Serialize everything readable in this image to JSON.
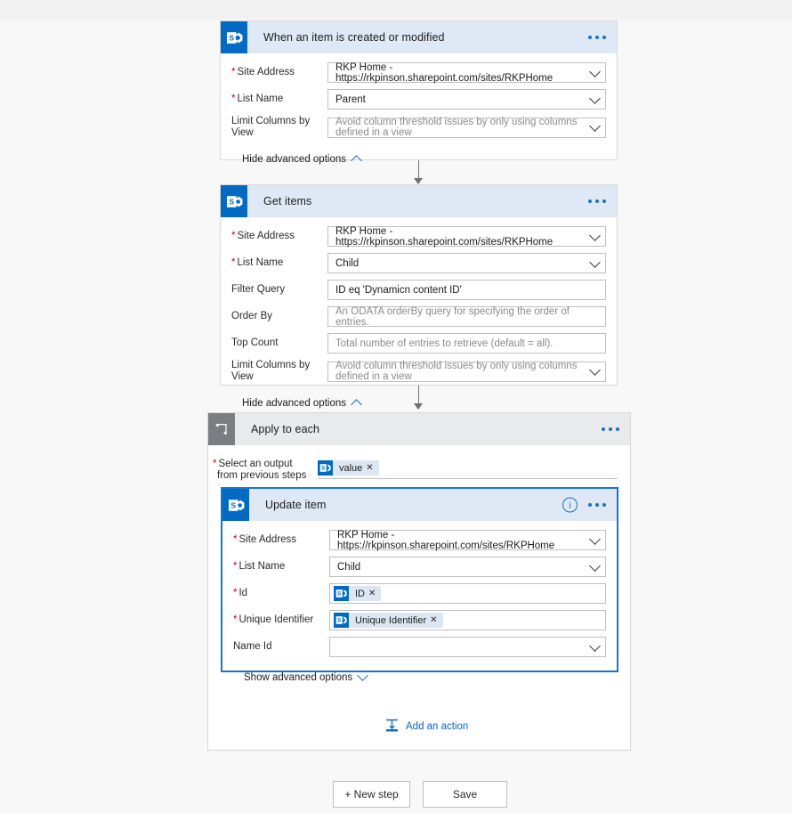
{
  "app": {
    "canvas_background": "#f8f8f8",
    "accent": "#036ac4",
    "selection_color": "#1775d1",
    "required_marker_color": "#d0021b"
  },
  "trigger_card": {
    "title": "When an item is created or modified",
    "icon": "sharepoint-icon",
    "menu_icon": "ellipsis-icon",
    "fields": [
      {
        "label": "Site Address",
        "required": true,
        "type": "dropdown",
        "value": "RKP Home - https://rkpinson.sharepoint.com/sites/RKPHome",
        "is_placeholder": false
      },
      {
        "label": "List Name",
        "required": true,
        "type": "dropdown",
        "value": "Parent",
        "is_placeholder": false
      },
      {
        "label": "Limit Columns by View",
        "required": false,
        "type": "dropdown",
        "value": "Avoid column threshold issues by only using columns defined in a view",
        "is_placeholder": true
      }
    ],
    "advanced_toggle": "Hide advanced options",
    "advanced_chevron": "chevron-up-icon"
  },
  "get_items_card": {
    "title": "Get items",
    "icon": "sharepoint-icon",
    "menu_icon": "ellipsis-icon",
    "fields": [
      {
        "label": "Site Address",
        "required": true,
        "type": "dropdown",
        "value": "RKP Home - https://rkpinson.sharepoint.com/sites/RKPHome",
        "is_placeholder": false
      },
      {
        "label": "List Name",
        "required": true,
        "type": "dropdown",
        "value": "Child",
        "is_placeholder": false
      },
      {
        "label": "Filter Query",
        "required": false,
        "type": "text",
        "value": "ID eq 'Dynamicn content ID'",
        "is_placeholder": false
      },
      {
        "label": "Order By",
        "required": false,
        "type": "text",
        "value": "An ODATA orderBy query for specifying the order of entries.",
        "is_placeholder": true
      },
      {
        "label": "Top Count",
        "required": false,
        "type": "text",
        "value": "Total number of entries to retrieve (default = all).",
        "is_placeholder": true
      },
      {
        "label": "Limit Columns by View",
        "required": false,
        "type": "dropdown",
        "value": "Avoid column threshold issues by only using columns defined in a view",
        "is_placeholder": true
      }
    ],
    "advanced_toggle": "Hide advanced options",
    "advanced_chevron": "chevron-up-icon"
  },
  "apply_to_each": {
    "title": "Apply to each",
    "icon": "foreach-loop-icon",
    "menu_icon": "ellipsis-icon",
    "output_label_line1": "Select an output",
    "output_label_line2": "from previous steps",
    "output_required": true,
    "output_token": {
      "text": "value",
      "icon": "sharepoint-icon",
      "remove_icon": "close-icon"
    },
    "add_action_label": "Add an action",
    "add_action_icon": "insert-action-icon"
  },
  "update_item_card": {
    "title": "Update item",
    "icon": "sharepoint-icon",
    "info_icon": "info-circle-icon",
    "menu_icon": "ellipsis-icon",
    "selected": true,
    "fields": [
      {
        "label": "Site Address",
        "required": true,
        "type": "dropdown",
        "value": "RKP Home - https://rkpinson.sharepoint.com/sites/RKPHome",
        "is_placeholder": false
      },
      {
        "label": "List Name",
        "required": true,
        "type": "dropdown",
        "value": "Child",
        "is_placeholder": false
      },
      {
        "label": "Id",
        "required": true,
        "type": "token",
        "token": {
          "text": "ID",
          "icon": "sharepoint-icon",
          "remove_icon": "close-icon"
        }
      },
      {
        "label": "Unique Identifier",
        "required": true,
        "type": "token",
        "token": {
          "text": "Unique Identifier",
          "icon": "sharepoint-icon",
          "remove_icon": "close-icon"
        }
      },
      {
        "label": "Name Id",
        "required": false,
        "type": "dropdown",
        "value": "",
        "is_placeholder": false
      }
    ],
    "advanced_toggle": "Show advanced options",
    "advanced_chevron": "chevron-down-icon"
  },
  "footer": {
    "new_step_label": "+ New step",
    "save_label": "Save"
  }
}
